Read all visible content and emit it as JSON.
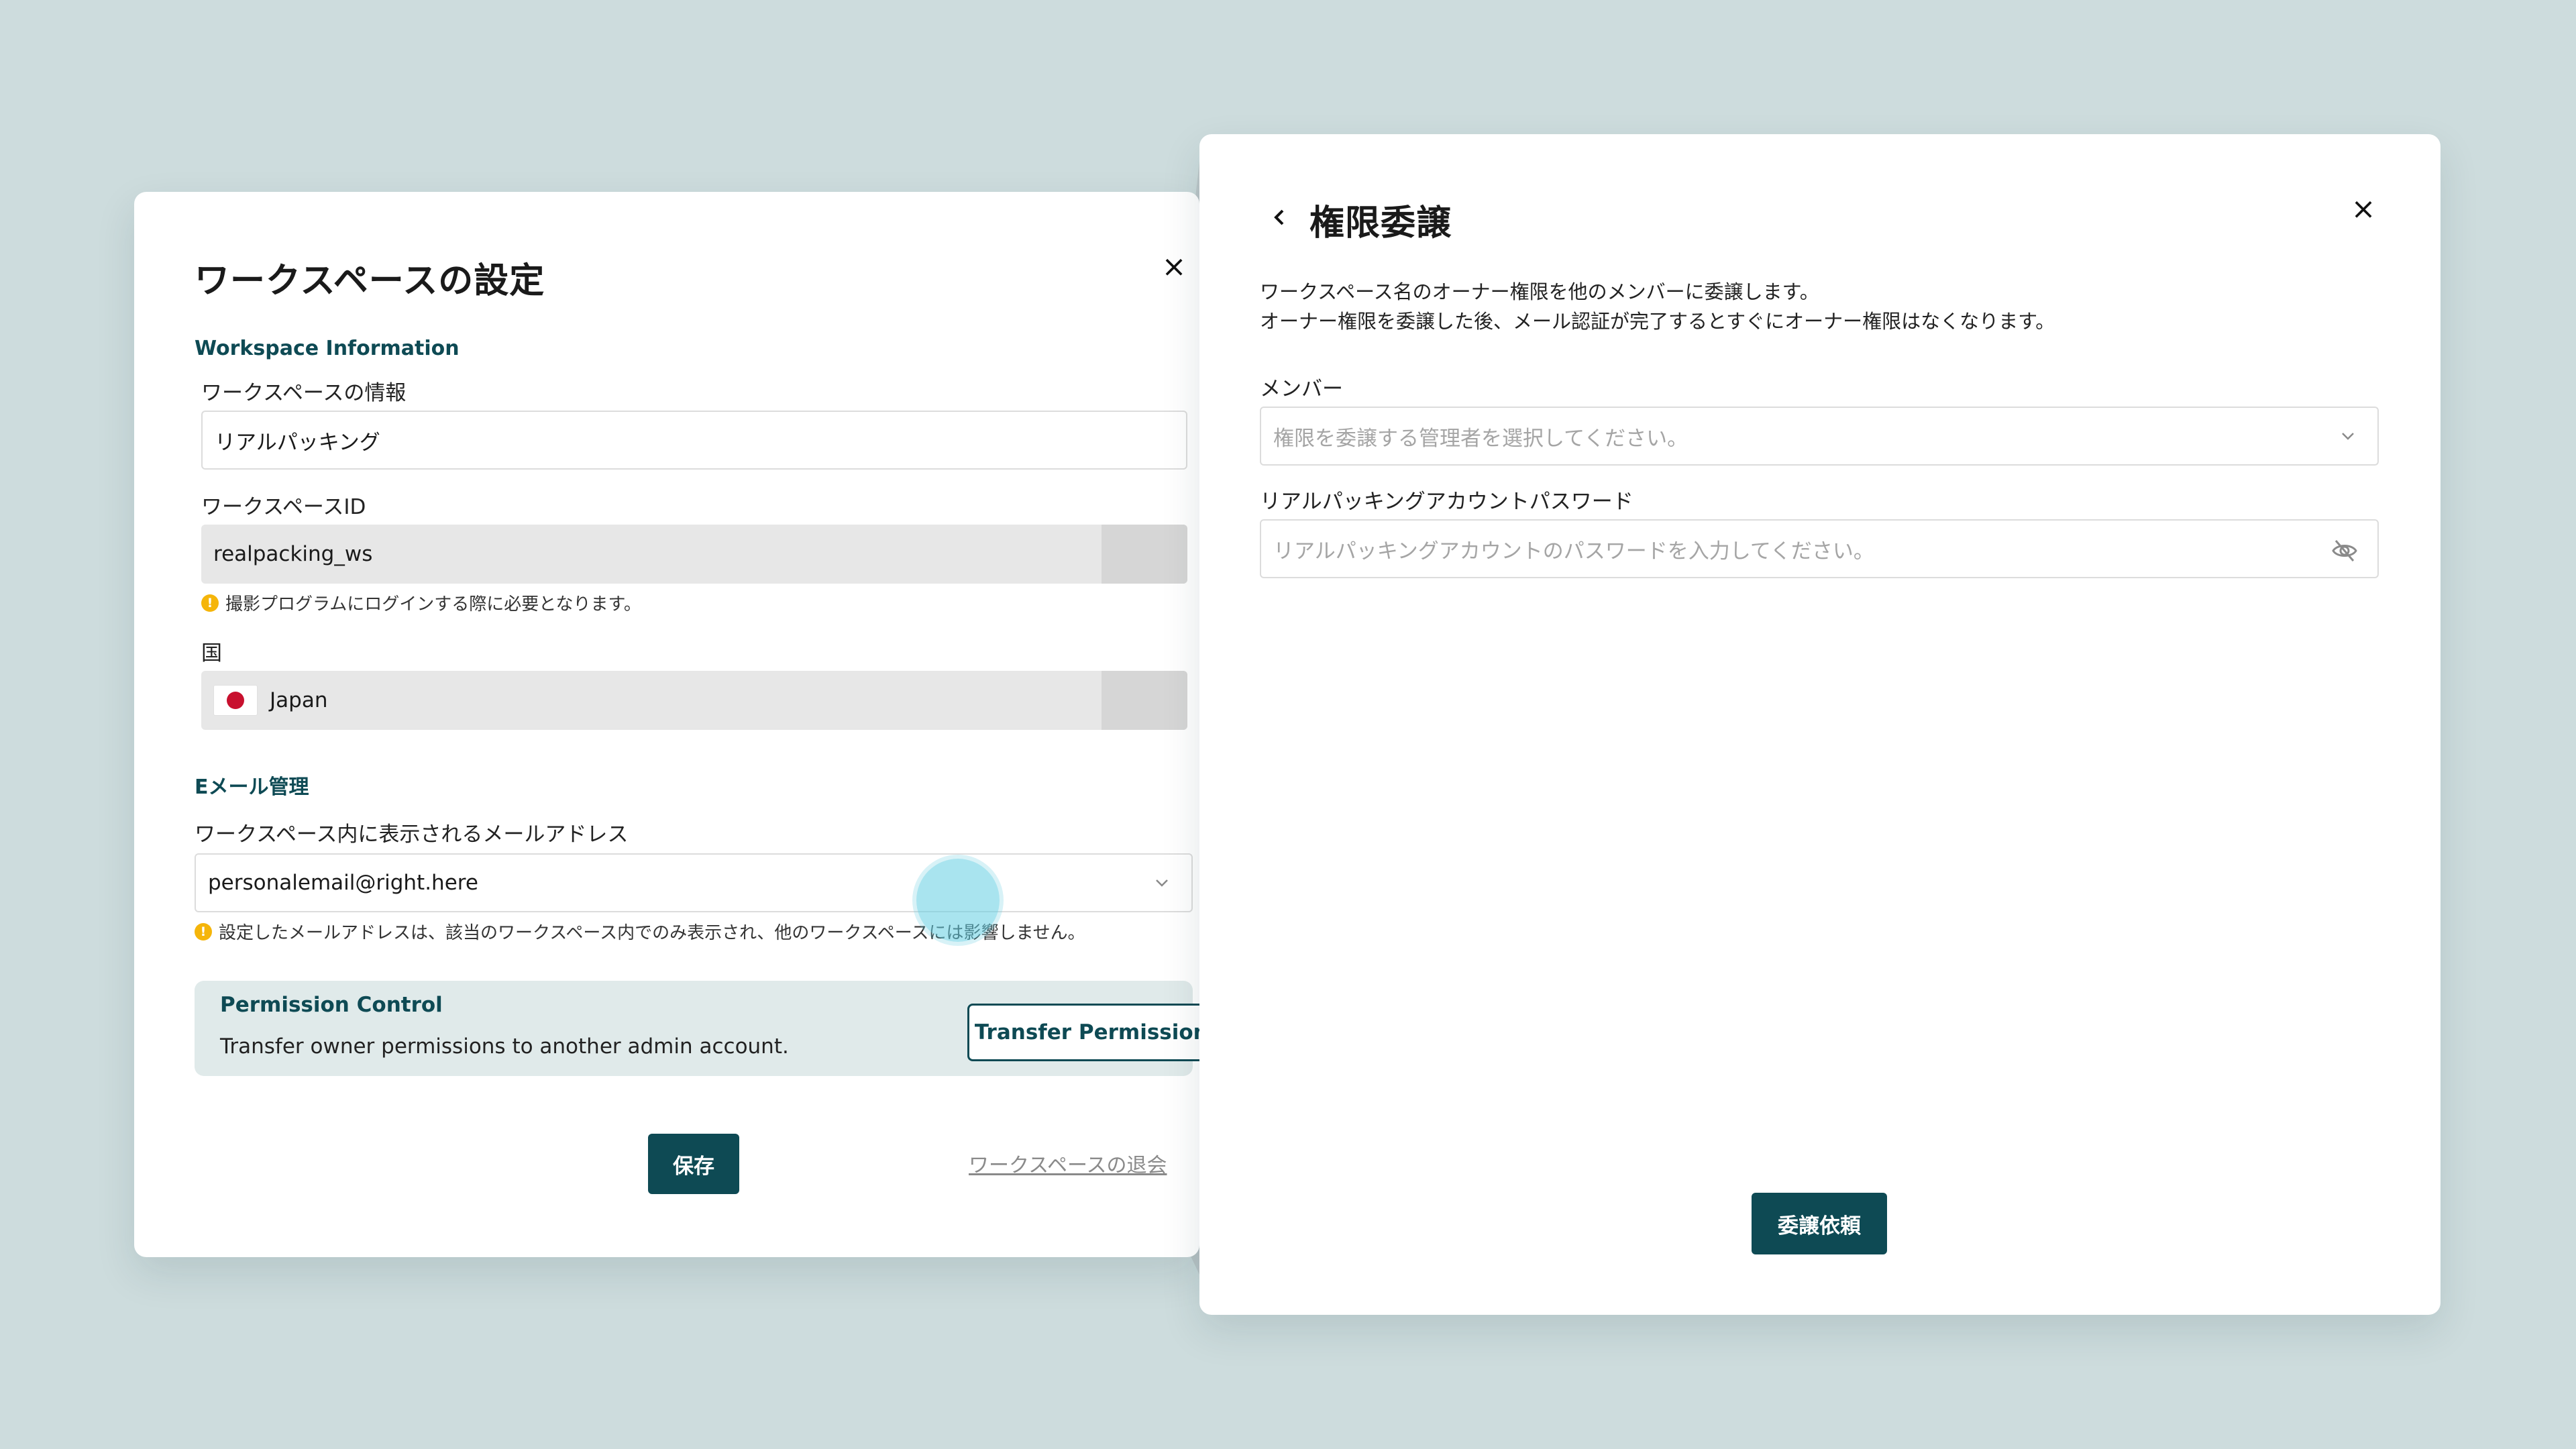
{
  "workspace_settings": {
    "title": "ワークスペースの設定",
    "section_info": "Workspace Information",
    "name_label": "ワークスペースの情報",
    "name_value": "リアルパッキング",
    "id_label": "ワークスペースID",
    "id_value": "realpacking_ws",
    "id_hint": "撮影プログラムにログインする際に必要となります。",
    "country_label": "国",
    "country_value": "Japan",
    "section_email": "Eメール管理",
    "email_label": "ワークスペース内に表示されるメールアドレス",
    "email_value": "personalemail@right.here",
    "email_hint": "設定したメールアドレスは、該当のワークスペース内でのみ表示され、他のワークスペースには影響しません。",
    "permission_title": "Permission Control",
    "permission_desc": "Transfer owner permissions to another admin account.",
    "transfer_button": "Transfer Permissions",
    "save_button": "保存",
    "leave_link": "ワークスペースの退会",
    "close_icon": "×"
  },
  "transfer_dialog": {
    "title": "権限委譲",
    "desc_line1": "ワークスペース名のオーナー権限を他のメンバーに委譲します。",
    "desc_line2": "オーナー権限を委譲した後、メール認証が完了するとすぐにオーナー権限はなくなります。",
    "member_label": "メンバー",
    "member_placeholder": "権限を委譲する管理者を選択してください。",
    "password_label": "リアルパッキングアカウントパスワード",
    "password_placeholder": "リアルパッキングアカウントのパスワードを入力してください。",
    "submit_button": "委譲依頼",
    "close_icon": "×"
  },
  "colors": {
    "background": "#cddcdd",
    "accent": "#0e4a54",
    "warning": "#f5b50a",
    "highlight": "#62cde1"
  },
  "icons": [
    "close-icon",
    "back-chevron-icon",
    "warning-icon",
    "japan-flag-icon",
    "chevron-down-icon",
    "eye-off-icon"
  ]
}
